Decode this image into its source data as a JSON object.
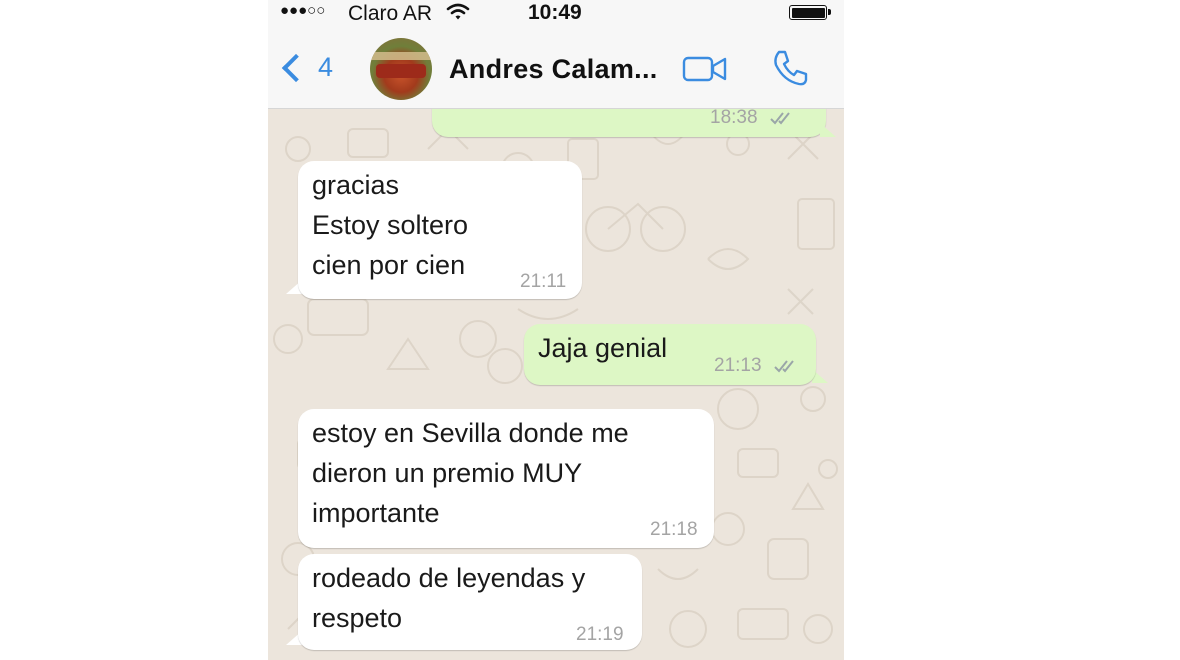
{
  "status_bar": {
    "signal": "●●●○○",
    "carrier": "Claro AR",
    "time": "10:49"
  },
  "nav": {
    "back_count": "4",
    "contact_name": "Andres Calam..."
  },
  "messages": [
    {
      "direction": "out",
      "text": "",
      "time": "18:38",
      "read": true
    },
    {
      "direction": "in",
      "text": "gracias\nEstoy soltero\ncien por cien",
      "time": "21:11"
    },
    {
      "direction": "out",
      "text": "Jaja genial",
      "time": "21:13",
      "read": true
    },
    {
      "direction": "in",
      "text": "estoy en Sevilla donde me\ndieron un premio MUY\nimportante",
      "time": "21:18"
    },
    {
      "direction": "in",
      "text": "rodeado de leyendas y\nrespeto",
      "time": "21:19"
    }
  ],
  "colors": {
    "accent": "#3b8ce0",
    "incoming_bubble": "#ffffff",
    "outgoing_bubble": "#ddf7c5",
    "chat_background": "#ece5dc",
    "read_ticks": "#9aa6a8"
  },
  "icons": [
    "back-chevron-icon",
    "video-call-icon",
    "phone-call-icon",
    "wifi-icon",
    "battery-icon",
    "double-check-icon"
  ]
}
